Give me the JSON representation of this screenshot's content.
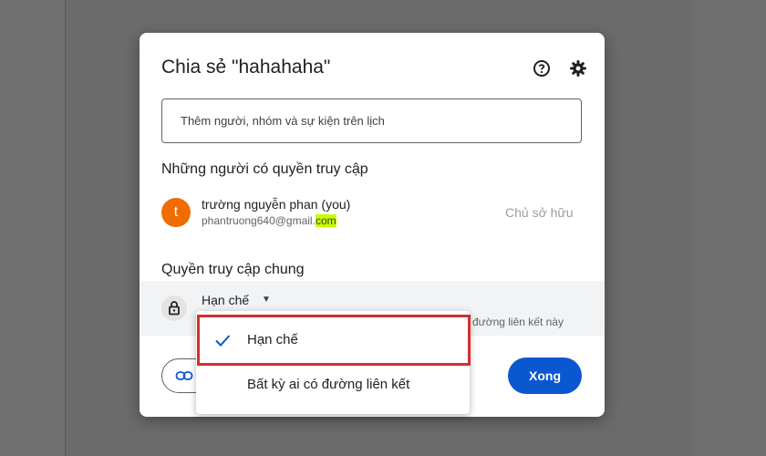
{
  "dialog": {
    "title": "Chia sẻ \"hahahaha\"",
    "add_placeholder": "Thêm người, nhóm và sự kiện trên lịch"
  },
  "people_section": {
    "heading": "Những người có quyền truy cập",
    "owner": {
      "initial": "t",
      "name": "trường nguyễn phan (you)",
      "email_prefix": "phantruong640@gmail.",
      "email_highlight": "com",
      "role": "Chủ sở hữu",
      "avatar_color": "#ef6c00"
    }
  },
  "general_access": {
    "heading": "Quyền truy cập chung",
    "current": "Hạn chế",
    "description_fragment": "g đường liên kết này"
  },
  "buttons": {
    "done": "Xong"
  },
  "menu": {
    "items": [
      {
        "label": "Hạn chế",
        "selected": true
      },
      {
        "label": "Bất kỳ ai có đường liên kết",
        "selected": false
      }
    ]
  },
  "colors": {
    "primary": "#0b57d0",
    "highlight_outline": "#d32f2f",
    "email_highlight": "#c6ff00"
  }
}
